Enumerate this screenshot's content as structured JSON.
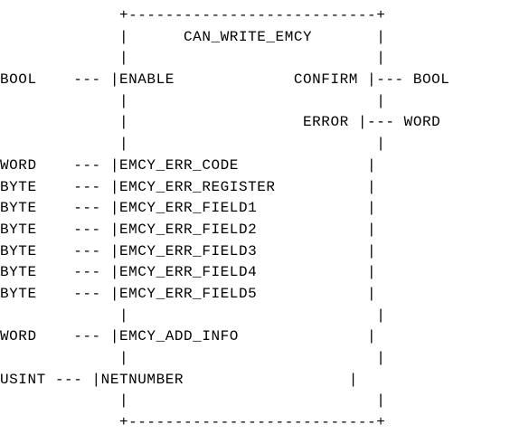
{
  "block": {
    "name": "CAN_WRITE_EMCY",
    "lines": [
      "             +---------------------------+",
      "             |      CAN_WRITE_EMCY       |",
      "             |                           |",
      "BOOL    --- |ENABLE             CONFIRM |--- BOOL",
      "             |                           |",
      "             |                   ERROR |--- WORD",
      "             |                           |",
      "WORD    --- |EMCY_ERR_CODE              |",
      "BYTE    --- |EMCY_ERR_REGISTER          |",
      "BYTE    --- |EMCY_ERR_FIELD1            |",
      "BYTE    --- |EMCY_ERR_FIELD2            |",
      "BYTE    --- |EMCY_ERR_FIELD3            |",
      "BYTE    --- |EMCY_ERR_FIELD4            |",
      "BYTE    --- |EMCY_ERR_FIELD5            |",
      "             |                           |",
      "WORD    --- |EMCY_ADD_INFO              |",
      "             |                           |",
      "USINT --- |NETNUMBER                  |",
      "             |                           |",
      "             +---------------------------+"
    ]
  }
}
